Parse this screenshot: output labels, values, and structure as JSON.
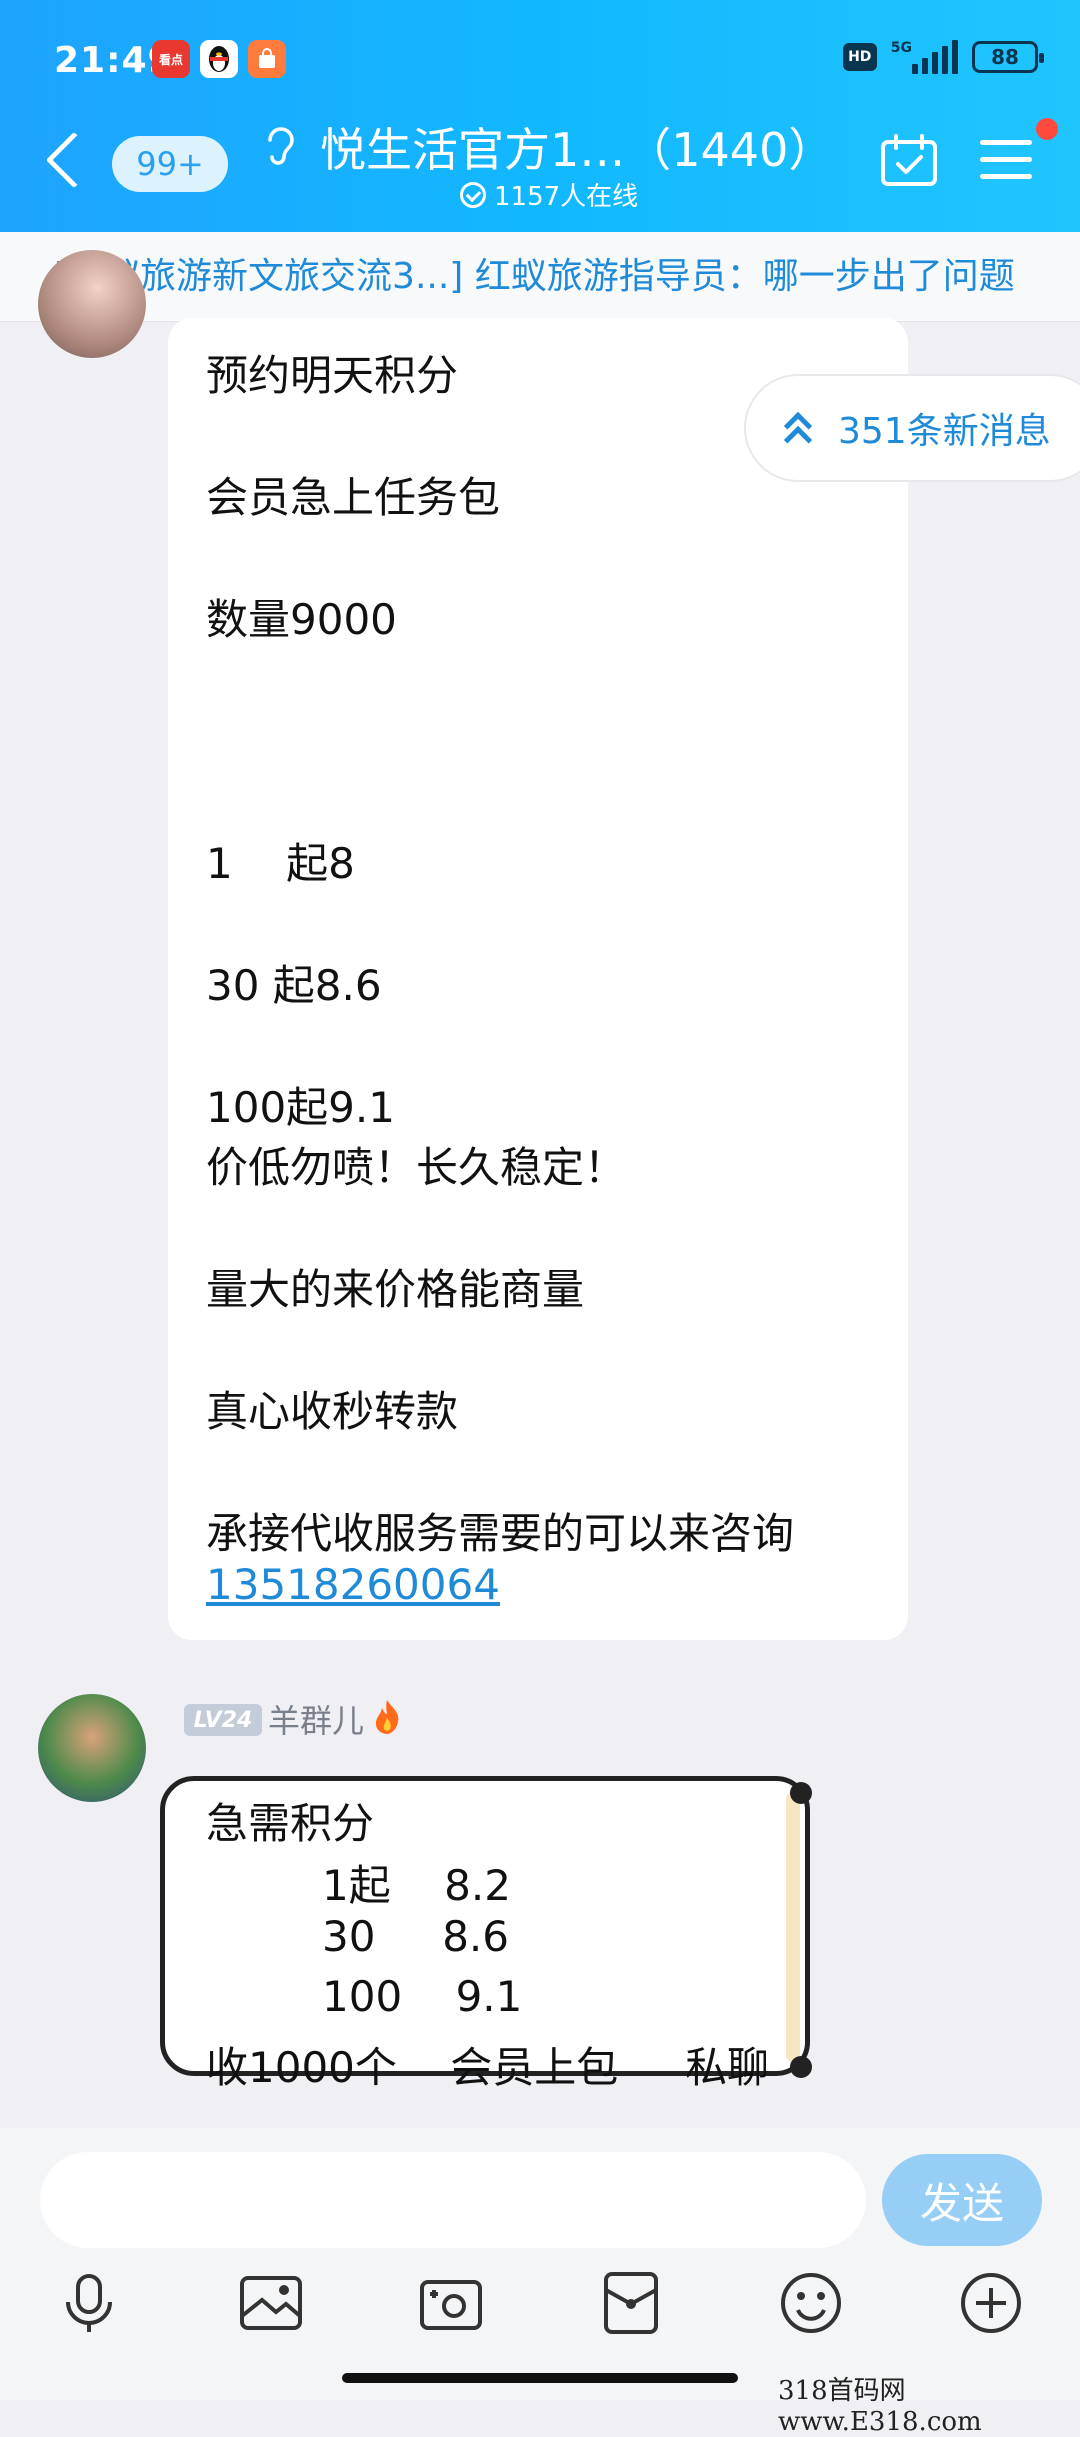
{
  "status_bar": {
    "time": "21:49",
    "network": "5G",
    "hd": "HD",
    "battery": "88"
  },
  "header": {
    "unread_badge": "99+",
    "title": "悦生活官方1…（1440）",
    "online": "1157人在线"
  },
  "pinned_message": "[红蚁旅游新文旅交流3...] 红蚁旅游指导员：哪一步出了问题",
  "new_messages": "351条新消息",
  "message1": {
    "lines": [
      "预约明天积分",
      "会员急上任务包",
      "数量9000",
      "1    起8",
      "30 起8.6",
      "100起9.1",
      "价低勿喷！长久稳定！",
      "量大的来价格能商量",
      "真心收秒转款",
      "承接代收服务需要的可以来咨询"
    ],
    "phone": "13518260064"
  },
  "message2": {
    "level": "LV24",
    "sender": "羊群儿",
    "lines": [
      "急需积分",
      "1起    8.2",
      "30     8.6",
      "100    9.1",
      "收1000个    会员上包     私聊"
    ]
  },
  "composer": {
    "send_label": "发送"
  },
  "watermark": "318首码网 www.E318.com",
  "colors": {
    "accent": "#1ea3ff",
    "link": "#1f8ad8",
    "notification": "#ff4a3d"
  }
}
